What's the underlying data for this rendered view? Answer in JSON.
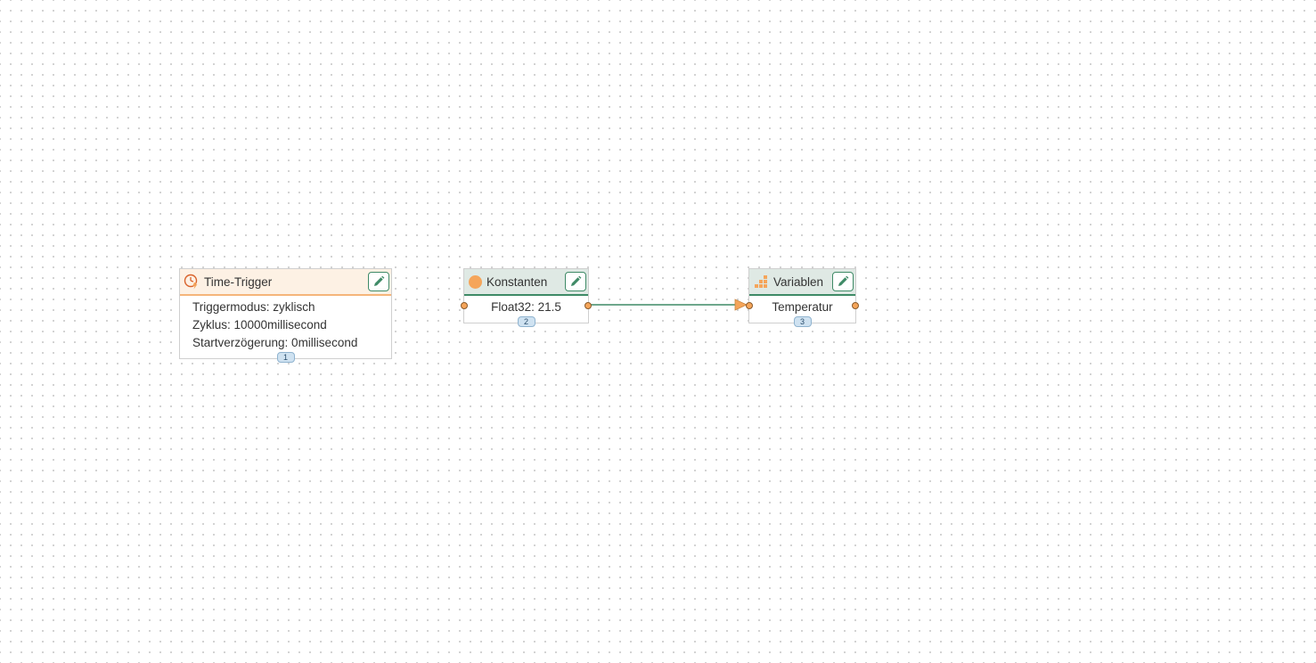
{
  "nodes": {
    "time_trigger": {
      "title": "Time-Trigger",
      "icon": "clock-trigger-icon",
      "lines": [
        "Triggermodus: zyklisch",
        "Zyklus: 10000millisecond",
        "Startverzögerung: 0millisecond"
      ],
      "badge": "1"
    },
    "konstanten": {
      "title": "Konstanten",
      "icon": "constant-circle-icon",
      "value": "Float32: 21.5",
      "badge": "2"
    },
    "variablen": {
      "title": "Variablen",
      "icon": "variable-blocks-icon",
      "value": "Temperatur",
      "badge": "3"
    }
  },
  "connections": [
    {
      "from": "konstanten",
      "to": "variablen"
    }
  ],
  "colors": {
    "trigger_header_bg": "#fdf1e4",
    "trigger_accent": "#f5b57a",
    "node_header_bg": "#dfe9e4",
    "node_accent": "#3e8a66",
    "port": "#f5a55a",
    "badge_bg": "#cfe2f1"
  }
}
